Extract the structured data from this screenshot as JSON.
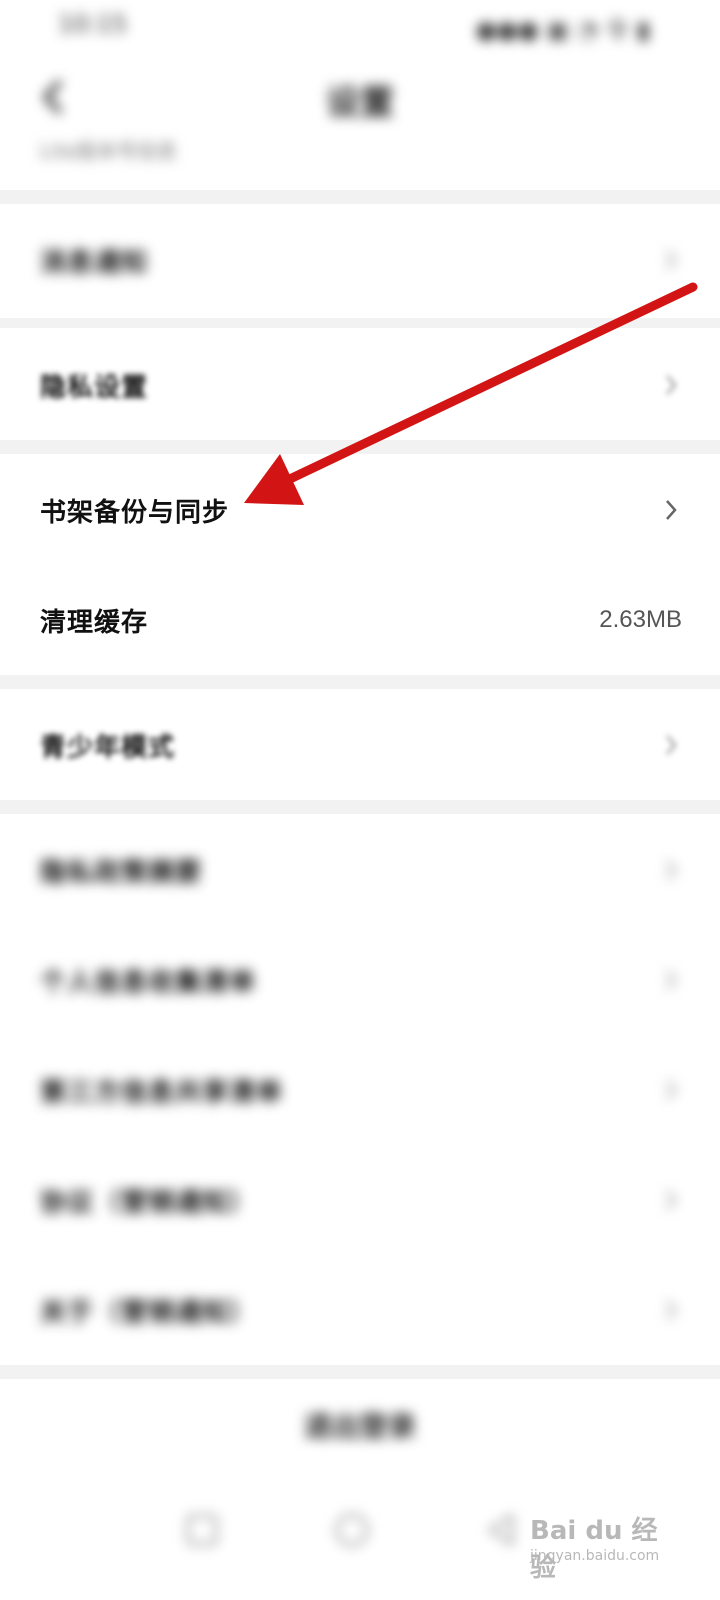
{
  "status_bar": {
    "time": "10:15",
    "icons_text": "●●● ▣ ◔ 令 ▮"
  },
  "nav": {
    "title": "设置",
    "subtitle": "Lite版本号信息"
  },
  "rows": [
    {
      "label": "消息通知",
      "value": ""
    },
    {
      "label": "隐私设置",
      "value": ""
    },
    {
      "label": "书架备份与同步",
      "value": ""
    },
    {
      "label": "清理缓存",
      "value": "2.63MB"
    },
    {
      "label": "青少年模式",
      "value": ""
    },
    {
      "label": "隐私政策摘要",
      "value": ""
    },
    {
      "label": "个人信息收集清单",
      "value": ""
    },
    {
      "label": "第三方信息共享清单",
      "value": ""
    },
    {
      "label": "协议（营销通知）",
      "value": ""
    },
    {
      "label": "关于（营销通知）",
      "value": ""
    }
  ],
  "bottom_action": {
    "label": "退出登录"
  },
  "watermark": {
    "brand": "Bai du 经验",
    "url": "jingyan.baidu.com"
  },
  "colors": {
    "annotation_red": "#d21414",
    "divider": "#f2f2f2"
  },
  "icons": {
    "back": "back-arrow-icon",
    "chevron": "chevron-right-icon"
  }
}
